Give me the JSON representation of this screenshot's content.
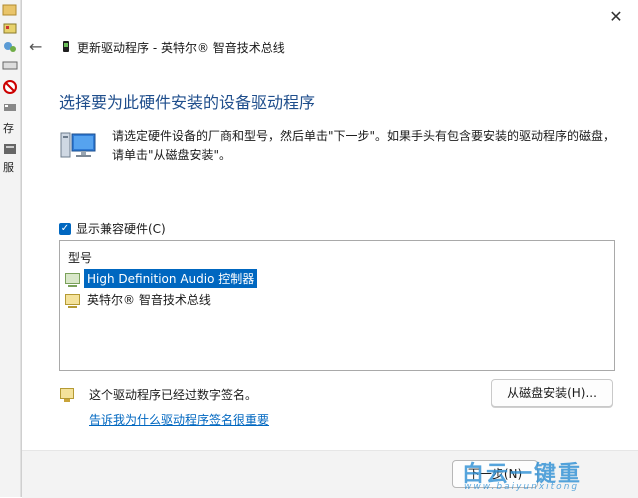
{
  "background_window": {
    "labels": [
      "存",
      "服"
    ]
  },
  "dialog": {
    "title": "更新驱动程序 - 英特尔® 智音技术总线",
    "heading": "选择要为此硬件安装的设备驱动程序",
    "instruction": "请选定硬件设备的厂商和型号，然后单击\"下一步\"。如果手头有包含要安装的驱动程序的磁盘，请单击\"从磁盘安装\"。",
    "compat_checkbox_label": "显示兼容硬件(C)",
    "compat_checked": true,
    "list_header": "型号",
    "models": [
      {
        "label": "High Definition Audio 控制器",
        "selected": true
      },
      {
        "label": "英特尔® 智音技术总线",
        "selected": false
      }
    ],
    "signed_text": "这个驱动程序已经过数字签名。",
    "disk_button": "从磁盘安装(H)...",
    "sign_link": "告诉我为什么驱动程序签名很重要",
    "next_button": "下一步(N)"
  },
  "watermark": {
    "main": "白云一键重",
    "sub": "www.baiyunxitong"
  },
  "colors": {
    "accent": "#0067c0",
    "heading": "#1f4e8c",
    "footer": "#f3f3f3"
  }
}
